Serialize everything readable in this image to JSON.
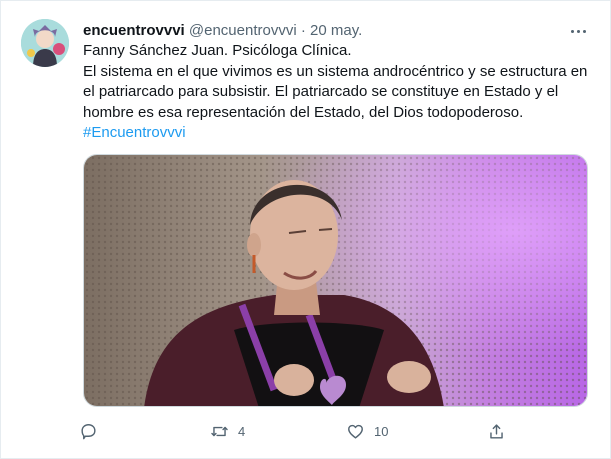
{
  "tweet": {
    "display_name": "encuentrovvvi",
    "handle": "@encuentrovvvi",
    "separator": "·",
    "date": "20 may.",
    "lines": [
      "Fanny Sánchez Juan. Psicóloga Clínica.",
      "El sistema en el que vivimos es un sistema androcéntrico y se estructura en el patriarcado para subsistir. El patriarcado se constituye en Estado y el hombre es esa representación del Estado, del Dios todopoderoso."
    ],
    "hashtag": "#Encuentrovvvi"
  },
  "actions": {
    "reply_count": "",
    "retweet_count": "4",
    "like_count": "10"
  },
  "icons": [
    "more-icon",
    "reply-icon",
    "retweet-icon",
    "like-icon",
    "share-icon"
  ],
  "colors": {
    "text": "#0f1419",
    "secondary": "#536471",
    "link": "#1d9bf0",
    "border": "#e6ecf0",
    "lanyard": "#8b3fa8"
  }
}
